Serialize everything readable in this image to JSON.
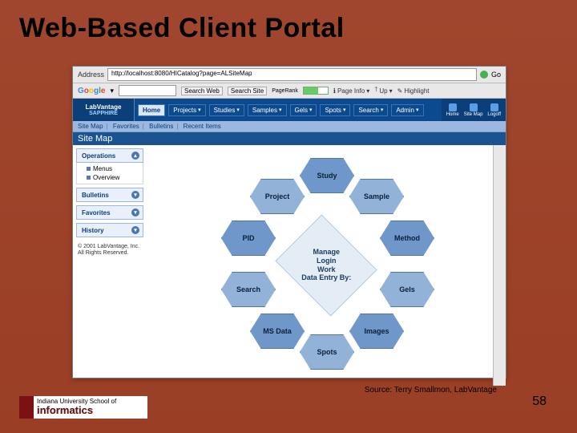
{
  "slide": {
    "title": "Web-Based Client Portal",
    "number": "58",
    "source": "Source: Terry Smallmon, LabVantage"
  },
  "footer_logo": {
    "top": "Indiana University School of",
    "main": "informatics"
  },
  "browser": {
    "address_label": "Address",
    "address_value": "http://localhost:8080/HICatalog?page=ALSiteMap",
    "go": "Go",
    "google_search_web": "Search Web",
    "google_search_site": "Search Site",
    "pagerank_label": "PageRank",
    "page_info": "Page Info",
    "up": "Up",
    "highlight": "Highlight"
  },
  "app": {
    "brand_top": "LabVantage",
    "brand_bot": "SAPPHIRE",
    "tabs": [
      "Home",
      "Projects",
      "Studies",
      "Samples",
      "Gels",
      "Spots",
      "Search",
      "Admin"
    ],
    "subnav": [
      "Site Map",
      "Favorites",
      "Bulletins",
      "Recent Items"
    ],
    "right_icons": [
      "Home",
      "Site Map",
      "Logoff"
    ],
    "sitemap_title": "Site Map"
  },
  "sidebar": {
    "items": [
      {
        "label": "Operations",
        "sub": [
          "Menus",
          "Overview"
        ]
      },
      {
        "label": "Bulletins"
      },
      {
        "label": "Favorites"
      },
      {
        "label": "History"
      }
    ],
    "copyright": "© 2001 LabVantage, Inc. All Rights Reserved."
  },
  "flower": {
    "center": [
      "Manage",
      "Login",
      "Work",
      "Data Entry By:"
    ],
    "petals": [
      "Study",
      "Sample",
      "Method",
      "Gels",
      "Images",
      "Spots",
      "MS Data",
      "Search",
      "PID",
      "Project"
    ]
  }
}
